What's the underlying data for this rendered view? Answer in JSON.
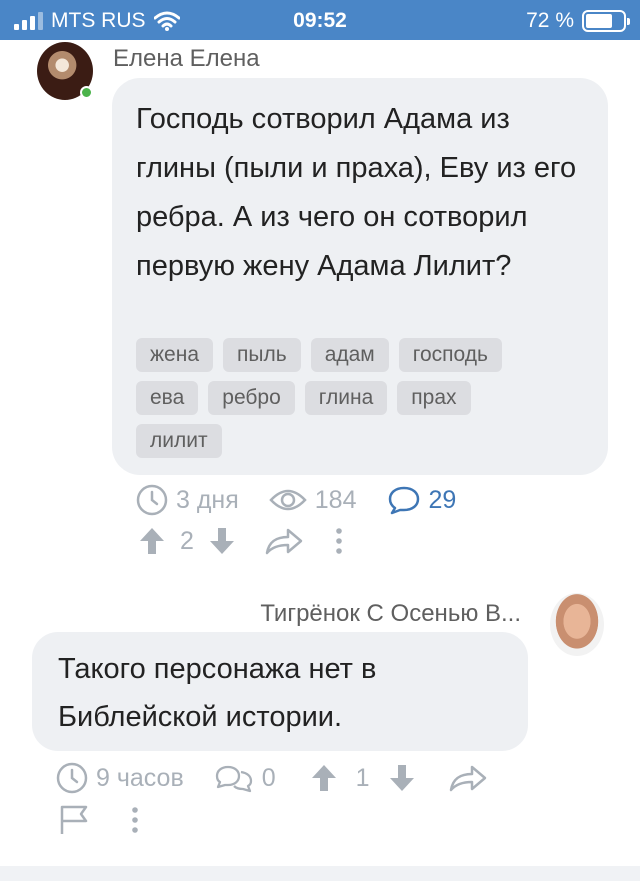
{
  "status_bar": {
    "carrier": "MTS RUS",
    "time": "09:52",
    "battery": "72 %",
    "battery_level": 0.72
  },
  "question": {
    "author": "Елена Елена",
    "text": "Господь сотворил Адама из глины (пыли и праха), Еву из его ребра. А из чего он сотворил первую жену Адама Лилит?",
    "tags": [
      "жена",
      "пыль",
      "адам",
      "господь",
      "ева",
      "ребро",
      "глина",
      "прах",
      "лилит"
    ],
    "time_ago": "3 дня",
    "views": "184",
    "comments": "29",
    "votes": "2"
  },
  "reply": {
    "author": "Тигрёнок С Осенью В...",
    "text": "Такого персонажа нет в Библейской истории.",
    "time_ago": "9 часов",
    "comments": "0",
    "votes": "1"
  },
  "colors": {
    "status_bar": "#4a86c7",
    "bubble": "#eef0f3",
    "tag": "#dcdde1",
    "meta_grey": "#a9b0b8",
    "accent_blue": "#3e76b5",
    "online": "#4bb34b"
  }
}
